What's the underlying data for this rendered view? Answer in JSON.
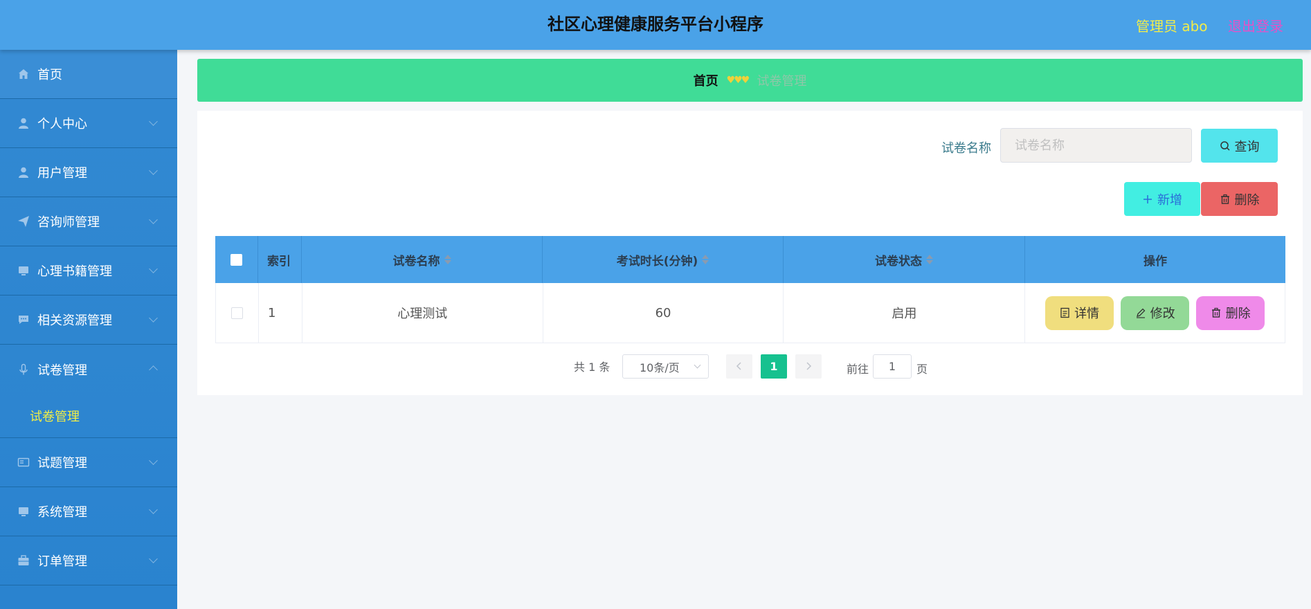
{
  "header": {
    "title": "社区心理健康服务平台小程序",
    "admin_label": "管理员 abo",
    "logout_label": "退出登录"
  },
  "sidebar": {
    "items": [
      {
        "label": "首页",
        "icon": "home-icon"
      },
      {
        "label": "个人中心",
        "icon": "user-icon"
      },
      {
        "label": "用户管理",
        "icon": "user-icon"
      },
      {
        "label": "咨询师管理",
        "icon": "paper-plane-icon"
      },
      {
        "label": "心理书籍管理",
        "icon": "monitor-icon"
      },
      {
        "label": "相关资源管理",
        "icon": "chat-icon"
      },
      {
        "label": "试卷管理",
        "icon": "microphone-icon",
        "expanded": true
      },
      {
        "label": "试题管理",
        "icon": "id-card-icon"
      },
      {
        "label": "系统管理",
        "icon": "monitor-icon"
      },
      {
        "label": "订单管理",
        "icon": "briefcase-icon"
      }
    ],
    "submenu": {
      "label": "试卷管理"
    }
  },
  "breadcrumb": {
    "home": "首页",
    "separator": "♥♥♥",
    "current": "试卷管理"
  },
  "search": {
    "label": "试卷名称",
    "placeholder": "试卷名称",
    "query_label": "查询"
  },
  "actions": {
    "add_label": "新增",
    "delete_label": "删除"
  },
  "table": {
    "headers": [
      "索引",
      "试卷名称",
      "考试时长(分钟)",
      "试卷状态",
      "操作"
    ],
    "rows": [
      {
        "index": "1",
        "name": "心理测试",
        "duration": "60",
        "status": "启用"
      }
    ],
    "row_actions": {
      "detail": "详情",
      "edit": "修改",
      "delete": "删除"
    }
  },
  "pagination": {
    "total": "共 1 条",
    "page_size": "10条/页",
    "current_page": "1",
    "goto_label": "前往",
    "goto_value": "1",
    "goto_suffix": "页"
  },
  "colors": {
    "header_bg": "#4aa2e8",
    "sidebar_bg": "#2a83cf",
    "breadcrumb_bg": "#40dc97",
    "active_submenu": "#f3ee45",
    "page_active": "#16c18f"
  }
}
